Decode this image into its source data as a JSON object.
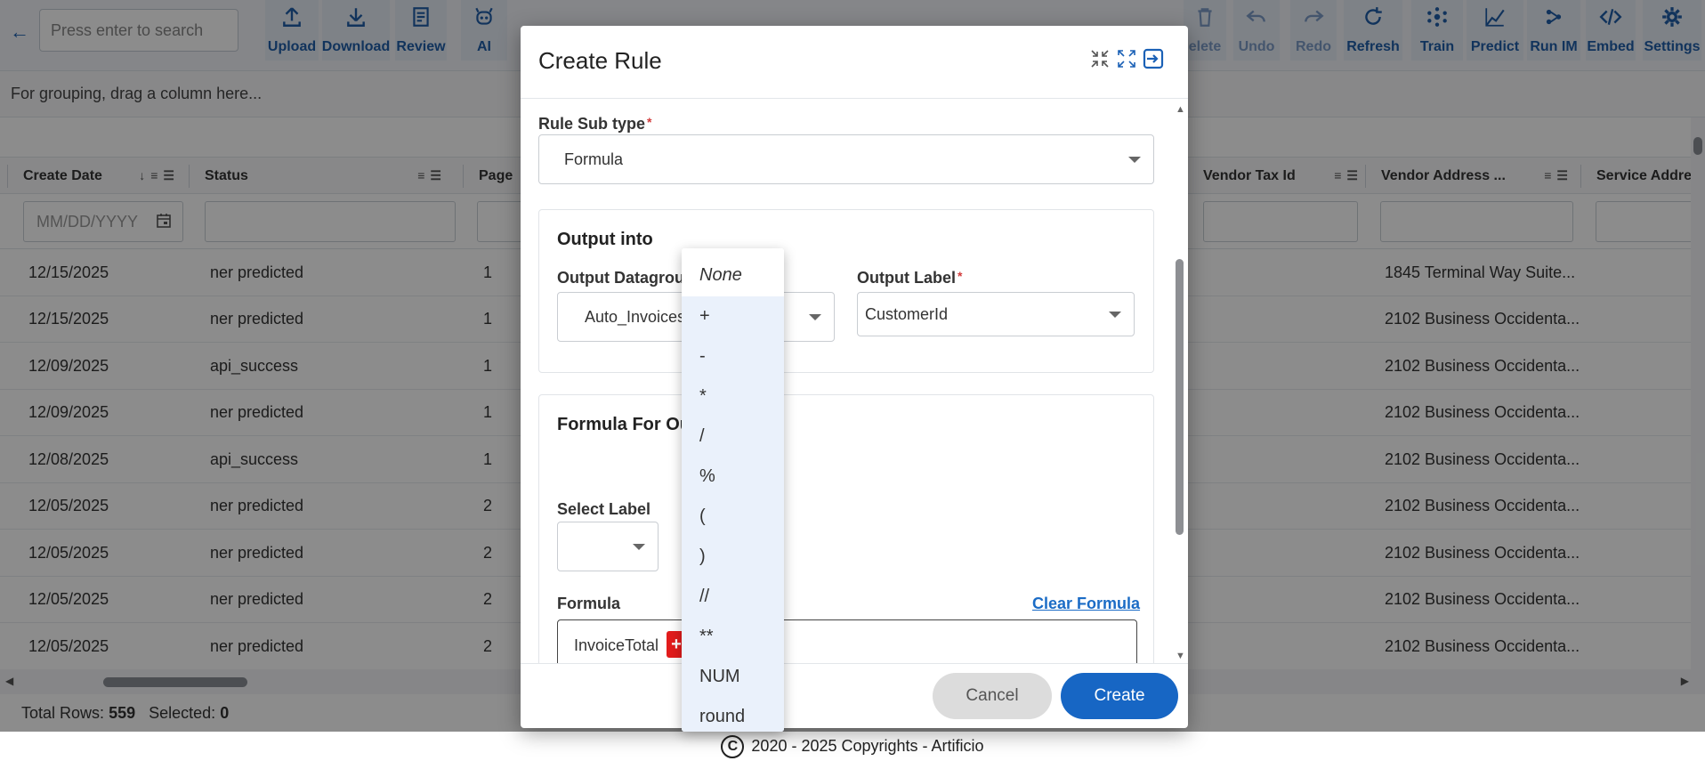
{
  "toolbar": {
    "search_placeholder": "Press enter to search",
    "buttons": [
      {
        "label": "Upload",
        "icon": "upload-icon"
      },
      {
        "label": "Download",
        "icon": "download-icon"
      },
      {
        "label": "Review",
        "icon": "review-icon"
      },
      {
        "label": "AI",
        "icon": "robot-icon"
      },
      {
        "label": "elete",
        "icon": "trash-icon"
      },
      {
        "label": "Undo",
        "icon": "undo-icon"
      },
      {
        "label": "Redo",
        "icon": "redo-icon"
      },
      {
        "label": "Refresh",
        "icon": "refresh-icon"
      },
      {
        "label": "Train",
        "icon": "train-icon"
      },
      {
        "label": "Predict",
        "icon": "predict-icon"
      },
      {
        "label": "Run IM",
        "icon": "run-im-icon"
      },
      {
        "label": "Embed",
        "icon": "embed-icon"
      },
      {
        "label": "Settings",
        "icon": "gear-icon"
      }
    ]
  },
  "grid": {
    "group_hint": "For grouping, drag a column here...",
    "columns": [
      "Create Date",
      "Status",
      "Page",
      "Vendor Tax Id",
      "Vendor Address ...",
      "Service Addre"
    ],
    "date_placeholder": "MM/DD/YYYY",
    "rows": [
      {
        "date": "12/15/2025",
        "status": "ner predicted",
        "page": "1",
        "vendor_address": "1845 Terminal Way Suite..."
      },
      {
        "date": "12/15/2025",
        "status": "ner predicted",
        "page": "1",
        "vendor_address": "2102 Business Occidenta..."
      },
      {
        "date": "12/09/2025",
        "status": "api_success",
        "page": "1",
        "vendor_address": "2102 Business Occidenta..."
      },
      {
        "date": "12/09/2025",
        "status": "ner predicted",
        "page": "1",
        "vendor_address": "2102 Business Occidenta..."
      },
      {
        "date": "12/08/2025",
        "status": "api_success",
        "page": "1",
        "vendor_address": "2102 Business Occidenta..."
      },
      {
        "date": "12/05/2025",
        "status": "ner predicted",
        "page": "2",
        "vendor_address": "2102 Business Occidenta..."
      },
      {
        "date": "12/05/2025",
        "status": "ner predicted",
        "page": "2",
        "vendor_address": "2102 Business Occidenta..."
      },
      {
        "date": "12/05/2025",
        "status": "ner predicted",
        "page": "2",
        "vendor_address": "2102 Business Occidenta..."
      },
      {
        "date": "12/05/2025",
        "status": "ner predicted",
        "page": "2",
        "vendor_address": "2102 Business Occidenta..."
      }
    ],
    "total_rows_label": "Total Rows:",
    "total_rows": "559",
    "selected_label": "Selected:",
    "selected": "0"
  },
  "footer": {
    "text": "2020 - 2025 Copyrights - Artificio"
  },
  "modal": {
    "title": "Create Rule",
    "rule_sub_type_label": "Rule Sub type",
    "rule_sub_type_value": "Formula",
    "output_into_title": "Output into",
    "output_datagroup_label": "Output Datagrou",
    "output_datagroup_value": "Auto_Invoices",
    "output_label_label": "Output Label",
    "output_label_value": "CustomerId",
    "formula_section_title": "Formula For Ou",
    "select_label_label": "Select Label",
    "formula_label": "Formula",
    "clear_formula": "Clear Formula",
    "formula_tokens": [
      "InvoiceTotal",
      "+"
    ],
    "cancel": "Cancel",
    "create": "Create"
  },
  "operator_dropdown": {
    "options": [
      "None",
      "+",
      "-",
      "*",
      "/",
      "%",
      "(",
      ")",
      "//",
      "**",
      "NUM",
      "round"
    ]
  },
  "colors": {
    "primary": "#1766c4",
    "danger": "#e21c1c",
    "overlay": "rgba(0,0,0,0.45)"
  }
}
